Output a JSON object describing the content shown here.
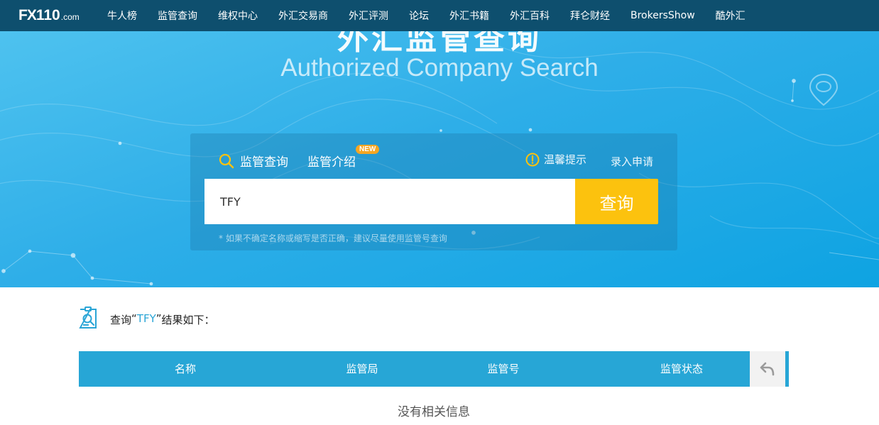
{
  "nav": {
    "logo": {
      "fx": "FX",
      "num": "110",
      "dom": ".com"
    },
    "items": [
      "牛人榜",
      "监管查询",
      "维权中心",
      "外汇交易商",
      "外汇评测",
      "论坛",
      "外汇书籍",
      "外汇百科",
      "拜仑财经",
      "BrokersShow",
      "酷外汇"
    ]
  },
  "hero": {
    "title_cn": "外汇监管查询",
    "title_en": "Authorized Company Search"
  },
  "search": {
    "tab_search": "监管查询",
    "tab_intro": "监管介绍",
    "new_badge": "NEW",
    "tips": "温馨提示",
    "apply": "录入申请",
    "input_value": "TFY",
    "button": "查询",
    "hint": "* 如果不确定名称或缩写是否正确，建议尽量使用监管号查询"
  },
  "results": {
    "prefix": "查询",
    "open_quote": "“",
    "query": "TFY",
    "close_quote": "”",
    "suffix": "结果如下：",
    "columns": [
      "名称",
      "监管局",
      "监管号",
      "监管状态"
    ],
    "empty": "没有相关信息"
  },
  "colors": {
    "nav_bg": "#0e4f6e",
    "hero_blue": "#2eaee8",
    "button_yellow": "#fcc20e",
    "table_header": "#27a6d6",
    "badge_orange": "#f5a623"
  }
}
